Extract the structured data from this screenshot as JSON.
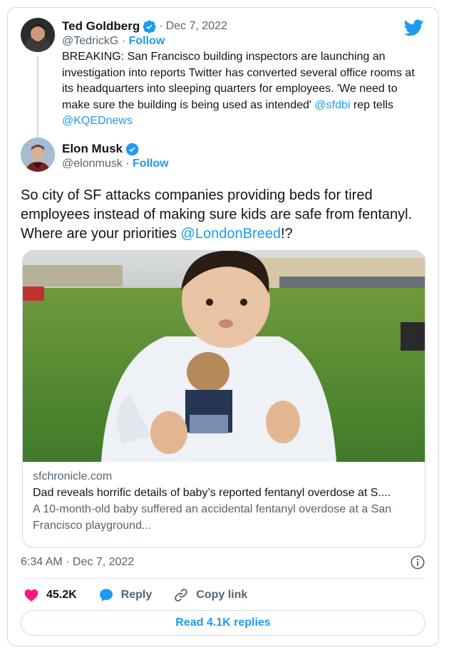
{
  "parent_tweet": {
    "display_name": "Ted Goldberg",
    "separator": "·",
    "date": "Dec 7, 2022",
    "handle": "@TedrickG",
    "follow_label": "Follow",
    "text_parts": [
      "BREAKING: San Francisco building inspectors are launching an investigation into reports Twitter has  converted several office rooms at its headquarters into sleeping quarters for employees. 'We need to make sure the building is being used as intended' ",
      "@sfdbi",
      " rep tells ",
      "@KQEDnews"
    ]
  },
  "main_tweet": {
    "display_name": "Elon Musk",
    "handle": "@elonmusk",
    "follow_label": "Follow",
    "text_before": "So city of SF attacks companies providing beds for tired employees instead of making sure kids are safe from fentanyl. Where are your priorities ",
    "mention": "@LondonBreed",
    "text_after": "!?",
    "link_card": {
      "domain": "sfchronicle.com",
      "title": "Dad reveals horrific details of baby’s reported fentanyl overdose at S....",
      "description": "A 10-month-old baby suffered an accidental fentanyl overdose at a San Francisco playground..."
    },
    "timestamp": "6:34 AM · Dec 7, 2022",
    "likes": "45.2K",
    "reply_label": "Reply",
    "copy_link_label": "Copy link",
    "read_replies_label": "Read 4.1K replies"
  },
  "colors": {
    "accent": "#1d9bf0",
    "like": "#f91880",
    "text_secondary": "#536471"
  },
  "icons": [
    "twitter-bird-icon",
    "verified-badge-icon",
    "info-icon",
    "heart-icon",
    "reply-bubble-icon",
    "link-icon"
  ]
}
